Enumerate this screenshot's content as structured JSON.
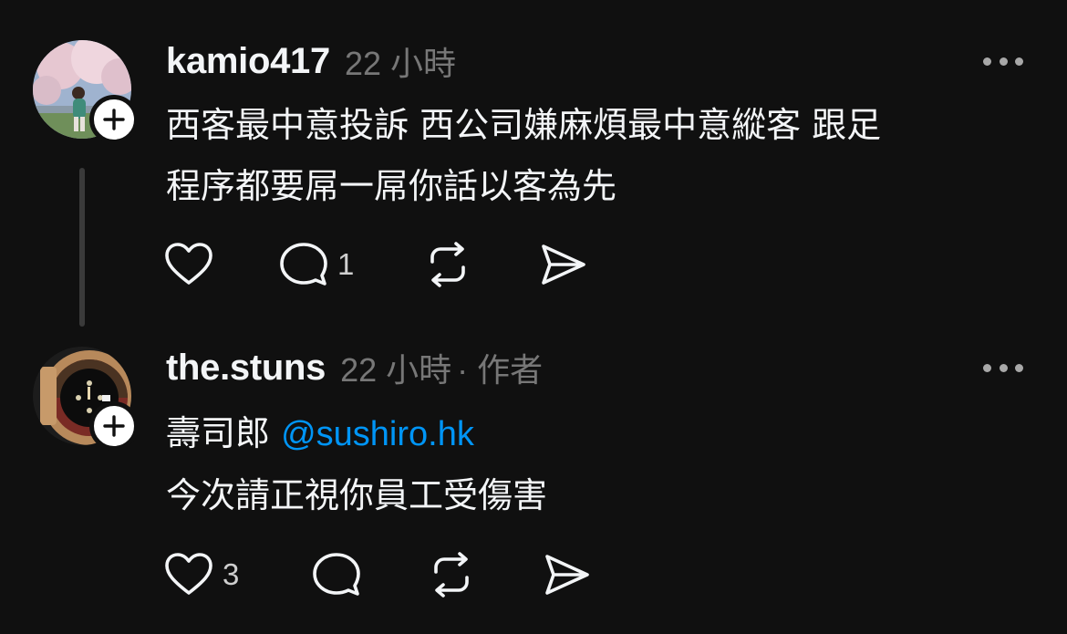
{
  "colors": {
    "background": "#101010",
    "primary_text": "#f3f5f7",
    "secondary_text": "#777777",
    "mention": "#0095f6",
    "thread_line": "#3a3a3a",
    "icon": "#f3f5f7"
  },
  "posts": [
    {
      "username": "kamio417",
      "timestamp": "22 小時",
      "author_tag": "",
      "text_lines": [
        "西客最中意投訴 西公司嫌麻煩最中意縱客 跟足",
        "程序都要屌一屌你話以客為先"
      ],
      "mention": "",
      "actions": {
        "like_icon": "heart-icon",
        "like_count": "",
        "reply_icon": "comment-icon",
        "reply_count": "1",
        "repost_icon": "repost-icon",
        "share_icon": "send-icon"
      }
    },
    {
      "username": "the.stuns",
      "timestamp": "22 小時",
      "author_tag": "· 作者",
      "text_lines": [
        "壽司郎 ",
        "今次請正視你員工受傷害"
      ],
      "mention": "@sushiro.hk",
      "actions": {
        "like_icon": "heart-icon",
        "like_count": "3",
        "reply_icon": "comment-icon",
        "reply_count": "",
        "repost_icon": "repost-icon",
        "share_icon": "send-icon"
      }
    }
  ]
}
